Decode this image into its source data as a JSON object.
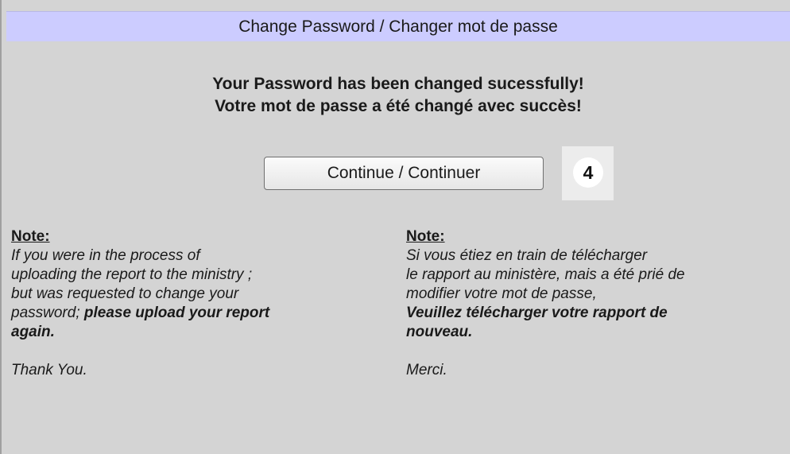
{
  "header": {
    "title": "Change Password / Changer mot de passe"
  },
  "message": {
    "line_en": "Your Password has been changed sucessfully!",
    "line_fr": "Votre mot de passe a été changé avec succès!"
  },
  "actions": {
    "continue_label": "Continue / Continuer"
  },
  "step_marker": "4",
  "note_en": {
    "title": "Note:",
    "line1": "If you were in the process of",
    "line2": "uploading the report to the ministry ;",
    "line3": "but was requested to change your",
    "line4_plain": "password; ",
    "line4_bold": "please upload your report",
    "line5_bold": "again.",
    "thanks": "Thank You."
  },
  "note_fr": {
    "title": "Note:",
    "line1": "Si vous étiez en train de télécharger",
    "line2": "le rapport au ministère, mais a été prié de",
    "line3": "modifier votre mot de passe,",
    "line4_bold": "Veuillez télécharger votre rapport de",
    "line5_bold": "nouveau.",
    "thanks": "Merci."
  }
}
